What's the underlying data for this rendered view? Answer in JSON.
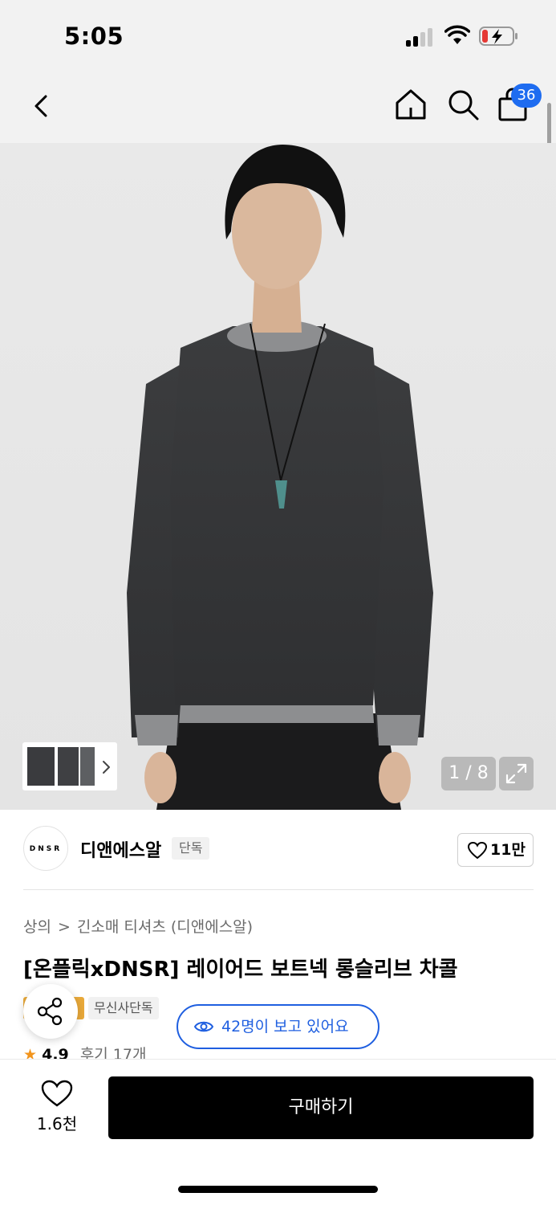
{
  "status_bar": {
    "time": "5:05"
  },
  "nav": {
    "cart_count": "36"
  },
  "gallery": {
    "counter": "1 / 8"
  },
  "brand": {
    "logo_text": "DNSR",
    "name": "디앤에스알",
    "tag": "단독",
    "likes": "11만"
  },
  "product": {
    "breadcrumb": [
      "상의",
      "긴소매 티셔츠 (디앤에스알)"
    ],
    "title": "[온플릭xDNSR] 레이어드 보트넥 롱슬리브 차콜",
    "exclusive_tag": "무신사단독",
    "viewers": "42명이 보고 있어요",
    "rating": "4.9",
    "reviews": "후기 17개"
  },
  "bottom": {
    "wish_count": "1.6천",
    "buy_label": "구매하기"
  },
  "colors": {
    "accent": "#1f5fe0",
    "badge": "#1e6cf0",
    "star": "#f2941c",
    "buy_button": "#000000"
  }
}
